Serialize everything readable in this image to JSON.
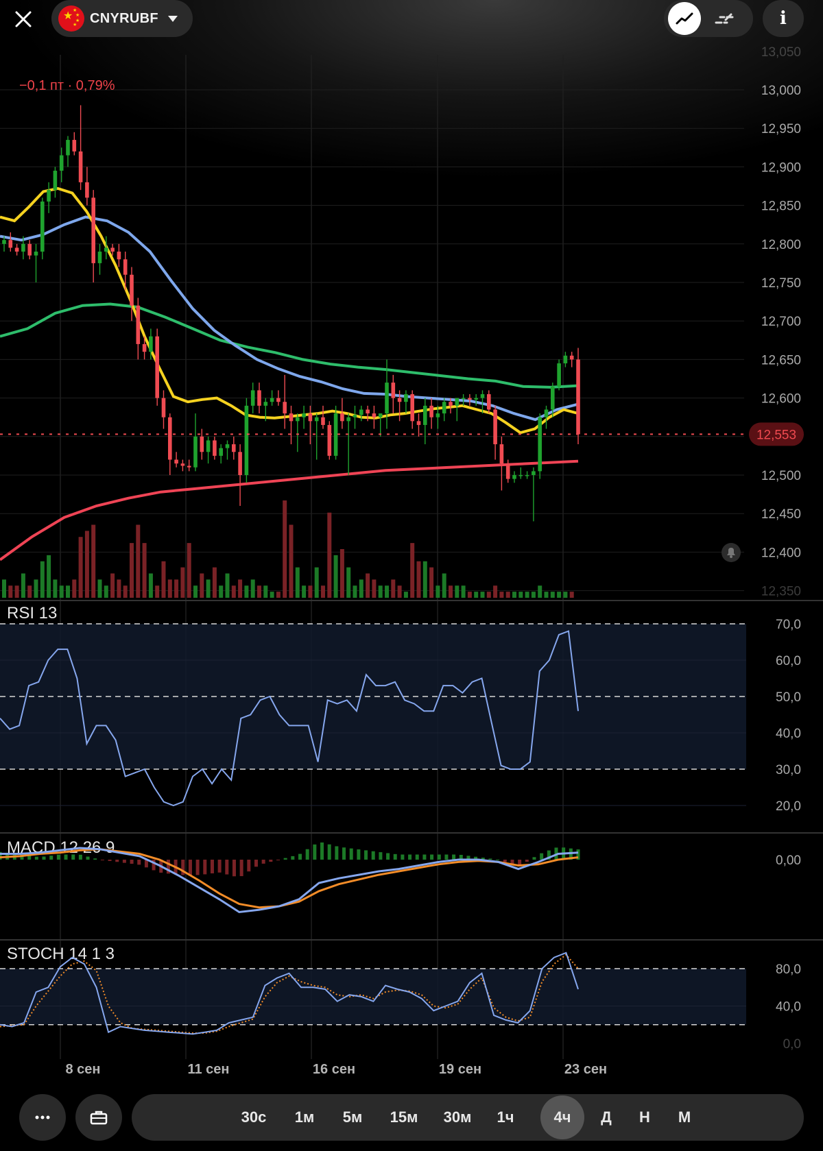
{
  "header": {
    "ticker": "CNYRUBF",
    "change_text": "−0,1 пт · 0,79%",
    "info_label": "i"
  },
  "price_axis": {
    "labels": [
      "13,050",
      "13,000",
      "12,950",
      "12,900",
      "12,850",
      "12,800",
      "12,750",
      "12,700",
      "12,650",
      "12,600",
      "12,550",
      "12,500",
      "12,450",
      "12,400",
      "12,350"
    ],
    "current_price": "12,553"
  },
  "panels": {
    "rsi": {
      "title": "RSI 13",
      "labels": [
        "70,0",
        "60,0",
        "50,0",
        "40,0",
        "30,0",
        "20,0"
      ]
    },
    "macd": {
      "title": "MACD 12 26 9",
      "labels": [
        "0,00"
      ]
    },
    "stoch": {
      "title": "STOCH 14 1 3",
      "labels": [
        "80,0",
        "40,0",
        "0,0"
      ]
    }
  },
  "dates": [
    "8 сен",
    "11 сен",
    "16 сен",
    "19 сен",
    "23 сен"
  ],
  "timeframes": [
    "30с",
    "1м",
    "5м",
    "15м",
    "30м",
    "1ч",
    "4ч",
    "Д",
    "Н",
    "М"
  ],
  "active_timeframe": "4ч",
  "colors": {
    "up": "#1fa32e",
    "down": "#ef4b52",
    "ema_fast": "#f5d220",
    "ema_mid": "#7ea7ec",
    "ema_slow": "#2ebd6b",
    "ema_long": "#ef4455",
    "rsi": "#86a7ee",
    "macd_signal": "#f28c28",
    "stoch_signal": "#f28c28"
  },
  "chart_data": {
    "type": "candlestick",
    "price_range": [
      12350,
      13050
    ],
    "candles": [
      [
        12800,
        12810,
        12790,
        12805
      ],
      [
        12805,
        12815,
        12790,
        12795
      ],
      [
        12795,
        12800,
        12785,
        12790
      ],
      [
        12790,
        12810,
        12780,
        12800
      ],
      [
        12800,
        12805,
        12780,
        12785
      ],
      [
        12785,
        12800,
        12750,
        12790
      ],
      [
        12790,
        12860,
        12780,
        12855
      ],
      [
        12855,
        12880,
        12840,
        12870
      ],
      [
        12870,
        12900,
        12860,
        12895
      ],
      [
        12895,
        12925,
        12880,
        12915
      ],
      [
        12915,
        12940,
        12900,
        12935
      ],
      [
        12935,
        12945,
        12915,
        12920
      ],
      [
        12920,
        12980,
        12870,
        12880
      ],
      [
        12880,
        12900,
        12850,
        12860
      ],
      [
        12860,
        12870,
        12750,
        12775
      ],
      [
        12775,
        12800,
        12760,
        12790
      ],
      [
        12790,
        12810,
        12780,
        12795
      ],
      [
        12795,
        12800,
        12785,
        12790
      ],
      [
        12790,
        12800,
        12770,
        12780
      ],
      [
        12780,
        12790,
        12740,
        12760
      ],
      [
        12760,
        12770,
        12700,
        12720
      ],
      [
        12720,
        12730,
        12650,
        12670
      ],
      [
        12670,
        12680,
        12650,
        12660
      ],
      [
        12660,
        12690,
        12650,
        12680
      ],
      [
        12680,
        12690,
        12590,
        12600
      ],
      [
        12600,
        12610,
        12560,
        12575
      ],
      [
        12575,
        12580,
        12500,
        12520
      ],
      [
        12520,
        12530,
        12510,
        12515
      ],
      [
        12515,
        12520,
        12505,
        12512
      ],
      [
        12512,
        12520,
        12505,
        12510
      ],
      [
        12510,
        12580,
        12505,
        12550
      ],
      [
        12550,
        12560,
        12520,
        12530
      ],
      [
        12530,
        12550,
        12515,
        12545
      ],
      [
        12545,
        12550,
        12520,
        12525
      ],
      [
        12525,
        12540,
        12515,
        12535
      ],
      [
        12535,
        12545,
        12520,
        12540
      ],
      [
        12540,
        12550,
        12520,
        12530
      ],
      [
        12530,
        12540,
        12460,
        12500
      ],
      [
        12500,
        12600,
        12490,
        12590
      ],
      [
        12590,
        12620,
        12580,
        12610
      ],
      [
        12610,
        12620,
        12580,
        12590
      ],
      [
        12590,
        12600,
        12570,
        12595
      ],
      [
        12595,
        12610,
        12590,
        12600
      ],
      [
        12600,
        12610,
        12590,
        12595
      ],
      [
        12595,
        12630,
        12560,
        12580
      ],
      [
        12580,
        12590,
        12540,
        12570
      ],
      [
        12570,
        12580,
        12530,
        12575
      ],
      [
        12575,
        12590,
        12560,
        12580
      ],
      [
        12580,
        12590,
        12540,
        12570
      ],
      [
        12570,
        12580,
        12520,
        12575
      ],
      [
        12575,
        12590,
        12560,
        12565
      ],
      [
        12565,
        12570,
        12520,
        12525
      ],
      [
        12525,
        12590,
        12520,
        12580
      ],
      [
        12580,
        12600,
        12560,
        12570
      ],
      [
        12570,
        12580,
        12500,
        12575
      ],
      [
        12575,
        12590,
        12560,
        12578
      ],
      [
        12578,
        12590,
        12570,
        12585
      ],
      [
        12585,
        12590,
        12570,
        12580
      ],
      [
        12580,
        12590,
        12560,
        12575
      ],
      [
        12575,
        12580,
        12550,
        12580
      ],
      [
        12580,
        12650,
        12560,
        12620
      ],
      [
        12620,
        12630,
        12580,
        12600
      ],
      [
        12600,
        12610,
        12570,
        12595
      ],
      [
        12595,
        12610,
        12580,
        12605
      ],
      [
        12605,
        12610,
        12560,
        12570
      ],
      [
        12570,
        12580,
        12550,
        12565
      ],
      [
        12565,
        12600,
        12540,
        12590
      ],
      [
        12590,
        12600,
        12560,
        12575
      ],
      [
        12575,
        12590,
        12560,
        12580
      ],
      [
        12580,
        12600,
        12570,
        12595
      ],
      [
        12595,
        12600,
        12580,
        12590
      ],
      [
        12590,
        12600,
        12570,
        12600
      ],
      [
        12600,
        12605,
        12590,
        12600
      ],
      [
        12600,
        12605,
        12590,
        12598
      ],
      [
        12598,
        12605,
        12590,
        12600
      ],
      [
        12600,
        12610,
        12580,
        12605
      ],
      [
        12605,
        12610,
        12580,
        12585
      ],
      [
        12585,
        12590,
        12520,
        12540
      ],
      [
        12540,
        12550,
        12480,
        12515
      ],
      [
        12515,
        12520,
        12490,
        12495
      ],
      [
        12495,
        12505,
        12490,
        12500
      ],
      [
        12500,
        12510,
        12495,
        12500
      ],
      [
        12500,
        12505,
        12495,
        12500
      ],
      [
        12500,
        12510,
        12440,
        12505
      ],
      [
        12505,
        12580,
        12495,
        12575
      ],
      [
        12575,
        12590,
        12560,
        12585
      ],
      [
        12585,
        12620,
        12575,
        12615
      ],
      [
        12615,
        12650,
        12610,
        12645
      ],
      [
        12645,
        12660,
        12640,
        12655
      ],
      [
        12655,
        12660,
        12640,
        12650
      ],
      [
        12650,
        12665,
        12540,
        12553
      ]
    ],
    "volumes": [
      3,
      2,
      2,
      4,
      2,
      3,
      6,
      7,
      3,
      2,
      2,
      3,
      10,
      11,
      12,
      3,
      2,
      4,
      3,
      2,
      9,
      12,
      9,
      4,
      2,
      6,
      3,
      3,
      5,
      9,
      2,
      4,
      3,
      5,
      2,
      4,
      2,
      3,
      2,
      3,
      2,
      2,
      1,
      1,
      16,
      12,
      5,
      2,
      2,
      5,
      2,
      14,
      7,
      8,
      5,
      2,
      3,
      4,
      3,
      2,
      2,
      3,
      2,
      1,
      9,
      6,
      6,
      5,
      2,
      4,
      2,
      2,
      2,
      1,
      1,
      1,
      1,
      2,
      1,
      1,
      1,
      1,
      1,
      1,
      2,
      1,
      1,
      1,
      1,
      1
    ],
    "ema_fast": [
      12835,
      12830,
      12848,
      12868,
      12872,
      12866,
      12842,
      12810,
      12772,
      12728,
      12680,
      12640,
      12602,
      12595,
      12598,
      12600,
      12590,
      12578,
      12575,
      12574,
      12576,
      12578,
      12580,
      12583,
      12580,
      12575,
      12574,
      12578,
      12580,
      12583,
      12586,
      12588,
      12590,
      12585,
      12580,
      12568,
      12555,
      12560,
      12575,
      12585,
      12580
    ],
    "ema_mid": [
      12810,
      12805,
      12812,
      12825,
      12835,
      12830,
      12815,
      12790,
      12752,
      12716,
      12688,
      12668,
      12650,
      12638,
      12628,
      12621,
      12612,
      12606,
      12605,
      12602,
      12600,
      12598,
      12596,
      12590,
      12580,
      12572,
      12585,
      12592
    ],
    "ema_slow": [
      12680,
      12690,
      12710,
      12720,
      12722,
      12718,
      12705,
      12690,
      12675,
      12666,
      12659,
      12650,
      12644,
      12640,
      12637,
      12633,
      12629,
      12625,
      12622,
      12615,
      12614,
      12616
    ],
    "ema_long": [
      12390,
      12420,
      12445,
      12460,
      12470,
      12478,
      12482,
      12486,
      12490,
      12494,
      12498,
      12502,
      12506,
      12508,
      12510,
      12512,
      12514,
      12516,
      12518
    ],
    "rsi": [
      44,
      41,
      42,
      53,
      54,
      60,
      63,
      63,
      55,
      37,
      42,
      42,
      38,
      28,
      29,
      30,
      25,
      21,
      20,
      21,
      28,
      30,
      26,
      30,
      27,
      44,
      45,
      49,
      50,
      45,
      42,
      42,
      42,
      32,
      49,
      48,
      49,
      46,
      56,
      53,
      53,
      54,
      49,
      48,
      46,
      46,
      53,
      53,
      51,
      54,
      55,
      43,
      31,
      30,
      30,
      32,
      57,
      60,
      67,
      68,
      46
    ],
    "macd": [
      0.5,
      0.5,
      0.6,
      0.8,
      1.0,
      0.9,
      0.6,
      0.3,
      -0.5,
      -1.4,
      -2.4,
      -3.4,
      -4.5,
      -4.3,
      -4.0,
      -3.4,
      -2.0,
      -1.6,
      -1.3,
      -1.0,
      -0.8,
      -0.5,
      -0.2,
      0.0,
      0.0,
      -0.2,
      -0.8,
      -0.2,
      0.5,
      0.6
    ],
    "macd_signal": [
      0.2,
      0.3,
      0.5,
      0.6,
      0.8,
      0.9,
      0.7,
      0.5,
      0.0,
      -0.8,
      -1.8,
      -2.9,
      -3.8,
      -4.1,
      -4.0,
      -3.6,
      -2.7,
      -2.1,
      -1.7,
      -1.3,
      -1.0,
      -0.7,
      -0.4,
      -0.2,
      -0.1,
      -0.2,
      -0.5,
      -0.4,
      0.0,
      0.2
    ],
    "stoch": [
      20,
      18,
      22,
      55,
      60,
      82,
      92,
      85,
      60,
      12,
      18,
      16,
      14,
      13,
      12,
      11,
      10,
      12,
      14,
      22,
      25,
      28,
      62,
      70,
      75,
      60,
      60,
      58,
      45,
      52,
      50,
      45,
      62,
      58,
      55,
      48,
      35,
      40,
      45,
      65,
      75,
      30,
      25,
      22,
      35,
      80,
      92,
      97,
      58
    ],
    "stoch_signal": [
      18,
      19,
      20,
      40,
      56,
      72,
      85,
      88,
      78,
      40,
      22,
      16,
      15,
      14,
      13,
      12,
      11,
      11,
      13,
      18,
      22,
      26,
      50,
      65,
      72,
      66,
      62,
      60,
      52,
      50,
      52,
      48,
      55,
      57,
      56,
      52,
      40,
      38,
      42,
      58,
      70,
      38,
      28,
      24,
      28,
      66,
      85,
      95,
      80
    ]
  }
}
